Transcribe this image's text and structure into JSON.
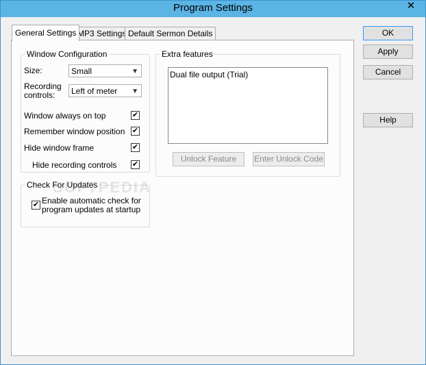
{
  "window": {
    "title": "Program Settings",
    "close_symbol": "✕"
  },
  "tabs": [
    {
      "label": "General Settings",
      "active": true
    },
    {
      "label": "MP3 Settings",
      "active": false
    },
    {
      "label": "Default Sermon Details",
      "active": false
    }
  ],
  "window_config": {
    "legend": "Window Configuration",
    "size_label": "Size:",
    "size_value": "Small",
    "recording_label_line1": "Recording",
    "recording_label_line2": "controls:",
    "recording_value": "Left of meter",
    "options": [
      {
        "label": "Window always on top",
        "checked": true
      },
      {
        "label": "Remember window position",
        "checked": true
      },
      {
        "label": "Hide window frame",
        "checked": true
      },
      {
        "label": "Hide recording controls",
        "checked": true
      }
    ]
  },
  "updates": {
    "legend": "Check For Updates",
    "auto_check_line1": "Enable automatic check for",
    "auto_check_line2": "program updates at startup",
    "checked": true
  },
  "extra": {
    "legend": "Extra features",
    "items": [
      "Dual file output (Trial)"
    ],
    "unlock_feature": "Unlock Feature",
    "enter_code": "Enter Unlock Code"
  },
  "buttons": {
    "ok": "OK",
    "apply": "Apply",
    "cancel": "Cancel",
    "help": "Help"
  },
  "check_glyph": "✔",
  "dropdown_glyph": "▼",
  "watermark": "SOFTPEDIA"
}
